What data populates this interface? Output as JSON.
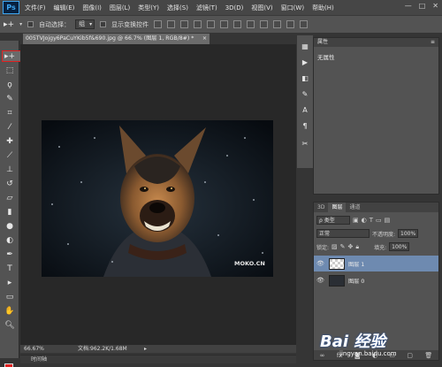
{
  "app": {
    "logo": "Ps"
  },
  "menu": [
    "文件(F)",
    "编辑(E)",
    "图像(I)",
    "图层(L)",
    "类型(Y)",
    "选择(S)",
    "滤镜(T)",
    "3D(D)",
    "视图(V)",
    "窗口(W)",
    "帮助(H)"
  ],
  "window_controls": {
    "minimize": "—",
    "maximize": "□",
    "close": "✕"
  },
  "options": {
    "auto_select_label": "自动选择：",
    "auto_select_value": "组",
    "show_transform_label": "显示变换控件"
  },
  "document": {
    "tab_title": "005TVJojgy6PaCuYKib5f&690.jpg @ 66.7% (图层 1, RGB/8#) *",
    "tab_close": "×",
    "zoom": "66.67%",
    "doc_size": "文档:962.2K/1.68M",
    "image_text": "MOKO.CN"
  },
  "timeline_label": "时间轴",
  "properties": {
    "title": "属性",
    "body": "无属性"
  },
  "layers": {
    "tabs": [
      "3D",
      "图层",
      "通道"
    ],
    "filter_kind": "ρ 类型",
    "blend_mode": "正常",
    "opacity_label": "不透明度:",
    "opacity_value": "100%",
    "lock_label": "锁定:",
    "fill_label": "填充:",
    "fill_value": "100%",
    "items": [
      {
        "name": "图层 1",
        "visible": true,
        "selected": true
      },
      {
        "name": "图层 0",
        "visible": true,
        "selected": false
      }
    ]
  },
  "watermark": {
    "brand": "Bai 经验",
    "url": "jingyan.baidu.com"
  },
  "colors": {
    "foreground": "#e02020",
    "background": "#ffffff",
    "selection": "#6e8ab0"
  }
}
